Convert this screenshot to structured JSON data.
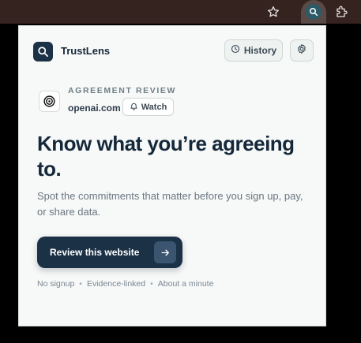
{
  "browser": {
    "bookmark_icon": "star-outline-icon",
    "extension_icon": "trustlens-extension-icon",
    "extensions_menu_icon": "puzzle-icon"
  },
  "header": {
    "app_name": "TrustLens",
    "history_label": "History",
    "history_icon": "clock-icon",
    "settings_icon": "gear-icon"
  },
  "site": {
    "kicker": "AGREEMENT REVIEW",
    "domain": "openai.com",
    "watch_label": "Watch",
    "watch_icon": "bell-icon",
    "site_icon": "openai-logo-icon"
  },
  "hero": {
    "headline": "Know what you’re agreeing to.",
    "subtext": "Spot the commitments that matter before you sign up, pay, or share data."
  },
  "cta": {
    "label": "Review this website",
    "icon": "arrow-right-icon"
  },
  "footnotes": [
    "No signup",
    "Evidence-linked",
    "About a minute"
  ],
  "colors": {
    "primary": "#1b3146",
    "accent_button": "#3b5570",
    "panel_bg": "#f7f8f8",
    "toolbar_bg": "#35231f"
  }
}
